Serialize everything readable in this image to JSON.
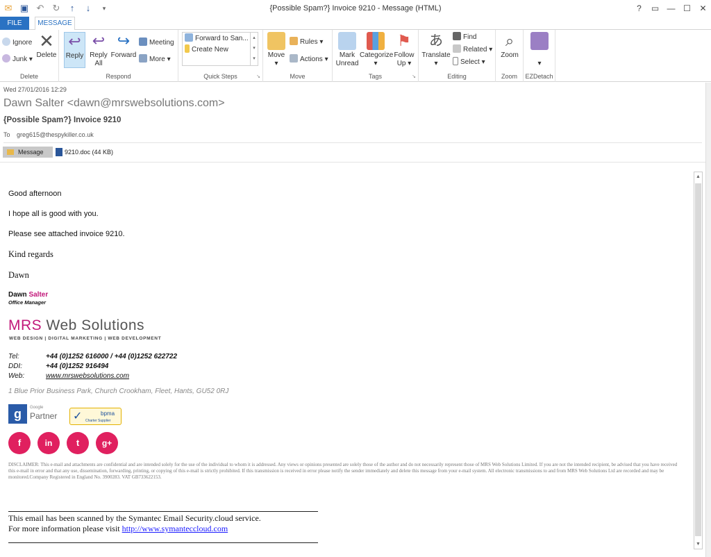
{
  "window": {
    "title": "{Possible Spam?} Invoice 9210 - Message (HTML)",
    "help": "?",
    "controls": [
      "▭",
      "—",
      "☐",
      "✕"
    ]
  },
  "tabs": {
    "file": "FILE",
    "message": "MESSAGE"
  },
  "ribbon": {
    "delete_group": {
      "label": "Delete",
      "ignore": "Ignore",
      "junk": "Junk",
      "delete": "Delete"
    },
    "respond_group": {
      "label": "Respond",
      "reply": "Reply",
      "reply_all_1": "Reply",
      "reply_all_2": "All",
      "forward": "Forward",
      "meeting": "Meeting",
      "more": "More"
    },
    "quick_steps": {
      "label": "Quick Steps",
      "item1": "Forward to San...",
      "item2": "Create New"
    },
    "move_group": {
      "label": "Move",
      "move": "Move",
      "rules": "Rules",
      "actions": "Actions"
    },
    "tags_group": {
      "label": "Tags",
      "mark_unread_1": "Mark",
      "mark_unread_2": "Unread",
      "categorize": "Categorize",
      "follow_up_1": "Follow",
      "follow_up_2": "Up"
    },
    "editing_group": {
      "label": "Editing",
      "translate": "Translate",
      "find": "Find",
      "related": "Related",
      "select": "Select"
    },
    "zoom_group": {
      "label": "Zoom",
      "zoom": "Zoom"
    },
    "ezdetach_group": {
      "label": "EZDetach"
    }
  },
  "header": {
    "date": "Wed 27/01/2016 12:29",
    "sender": "Dawn Salter <dawn@mrswebsolutions.com>",
    "subject": "{Possible Spam?} Invoice 9210",
    "to_label": "To",
    "to_value": "greg615@thespykiller.co.uk",
    "attachments": {
      "message": "Message",
      "file": "9210.doc (44 KB)"
    }
  },
  "body": {
    "greeting": "Good afternoon",
    "line1": "I hope all is good with you.",
    "line2": "Please see attached invoice 9210.",
    "regards": "Kind regards",
    "name": "Dawn",
    "sig_first": "Dawn",
    "sig_last": "Salter",
    "sig_title": "Office Manager",
    "logo_mrs": "MRS",
    "logo_rest": " Web Solutions",
    "tagline": "WEB DESIGN | DIGITAL MARKETING | WEB DEVELOPMENT",
    "tel_label": "Tel:",
    "tel_value": "+44 (0)1252 616000 / +44 (0)1252 622722",
    "ddi_label": "DDI:",
    "ddi_value": "+44 (0)1252 916494",
    "web_label": "Web:",
    "web_value": "www.mrswebsolutions.com",
    "address": "1 Blue Prior Business Park, Church Crookham, Fleet, Hants, GU52 0RJ",
    "google_small": "Google",
    "google_partner": "Partner",
    "bpma": "bpma",
    "bpma_sub": "Charter Supplier",
    "social": [
      "f",
      "in",
      "t",
      "g+"
    ],
    "disclaimer": "DISCLAIMER: This e-mail and attachments are confidential and are intended solely for the use of the individual to whom it is addressed. Any views or opinions presented are solely those of the author and do not necessarily represent those of MRS Web Solutions Limited. If you are not the intended recipient, be advised that you have received this e-mail in error and that any use, dissemination, forwarding, printing, or copying of this e-mail is strictly prohibited. If this transmission is received in error please notify the sender immediately and delete this message from your e-mail system. All electronic transmissions to and from MRS Web Solutions Ltd are recorded and may be monitored.Company Registered in England No. 3900283. VAT GB733622153.",
    "symantec_line1": "This email has been scanned by the Symantec Email Security.cloud service.",
    "symantec_line2_prefix": "For more information please visit ",
    "symantec_link": "http://www.symanteccloud.com"
  },
  "colors": {
    "accent": "#2a72c3",
    "brand_pink": "#c2187a",
    "social_pink": "#e0205f"
  }
}
